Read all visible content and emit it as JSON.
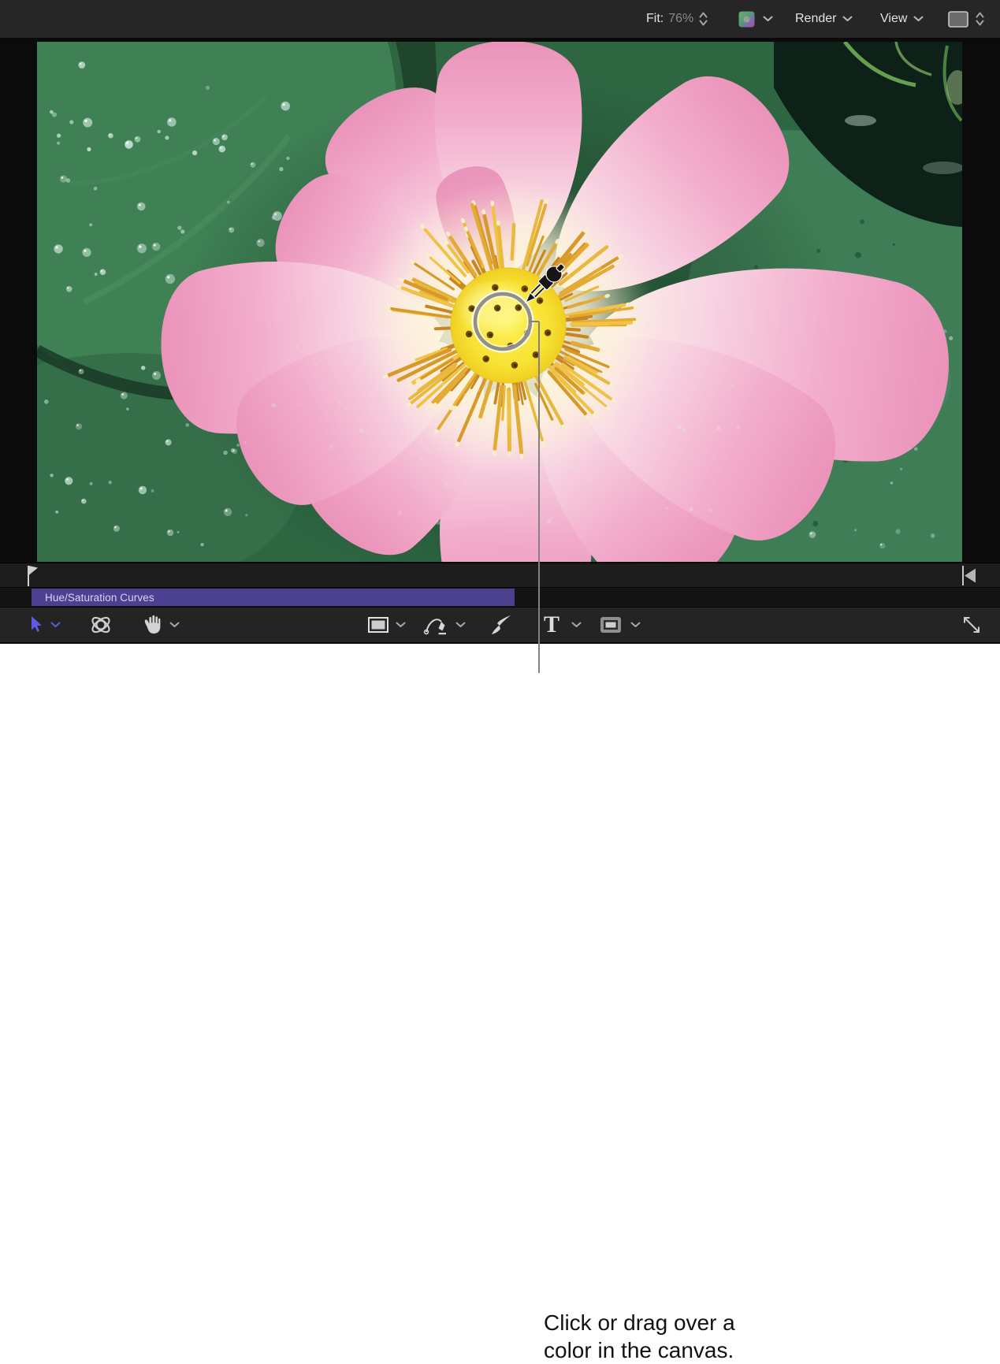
{
  "top_toolbar": {
    "fit_label": "Fit:",
    "fit_value": "76%",
    "render_label": "Render",
    "view_label": "View",
    "zoom_stepper_icon": "stepper-icon",
    "color_swatch_icon": "color-swatch-icon",
    "layers_icon": "canvas-layers-icon"
  },
  "timeline": {
    "clip_label": "Hue/Saturation Curves",
    "playhead_icon": "playhead-pin-icon",
    "end_icon": "timeline-end-icon"
  },
  "tools": {
    "select": "select-arrow-icon",
    "transform_3d": "orbit-3d-icon",
    "pan": "hand-icon",
    "rectangle": "rectangle-tool-icon",
    "bezier": "bezier-pen-tool-icon",
    "paint_stroke": "paint-stroke-tool-icon",
    "text": "text-tool-icon",
    "text_glyph": "T",
    "shape": "shape-tool-icon",
    "expand": "expand-icon"
  },
  "canvas": {
    "subject": "lotus flower on green lily pads",
    "overlays": [
      "eyedropper-cursor",
      "color-sample-circle",
      "callout-line"
    ]
  },
  "callout": {
    "line1": "Click or drag over a",
    "line2": "color in the canvas."
  },
  "colors": {
    "toolbar_bg": "#262626",
    "canvas_bg": "#0b0b0b",
    "timeline_clip": "#4c4191",
    "timeline_clip_text": "#d9d4f4",
    "accent_blue": "#5b5ce2",
    "pod_yellow": "#f8e233",
    "petal_pink": "#f2accb",
    "leaf_green": "#3e7d55"
  }
}
